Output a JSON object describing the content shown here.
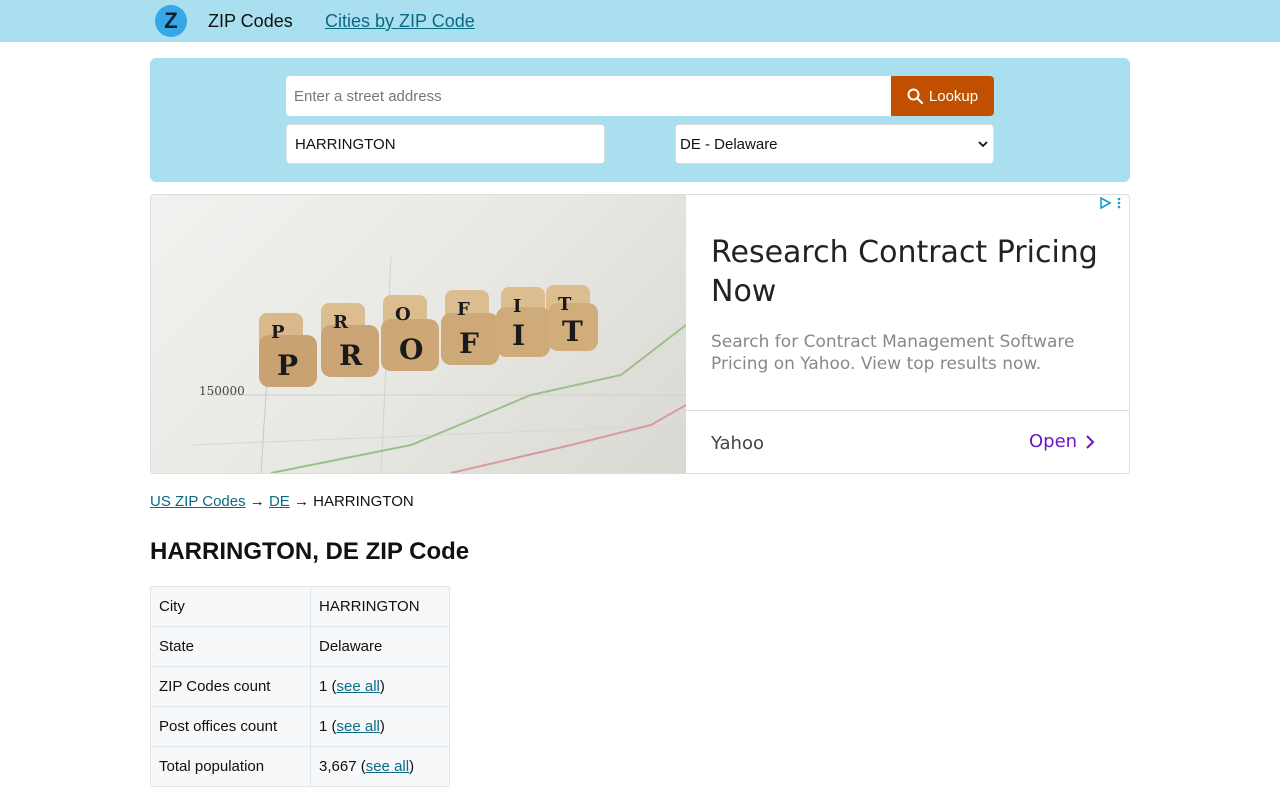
{
  "header": {
    "logo_letter": "Z",
    "brand": "ZIP Codes",
    "nav_link": "Cities by ZIP Code"
  },
  "search": {
    "address_placeholder": "Enter a street address",
    "address_value": "",
    "lookup_label": "Lookup",
    "city_value": "HARRINGTON",
    "state_selected": "DE - Delaware",
    "accent_color": "#c05000"
  },
  "ad": {
    "headline": "Research Contract Pricing Now",
    "description": "Search for Contract Management Software Pricing on Yahoo. View top results now.",
    "source": "Yahoo",
    "cta": "Open",
    "image_dice": [
      "P",
      "R",
      "O",
      "F",
      "I",
      "T"
    ],
    "image_axis_label": "150000"
  },
  "breadcrumb": {
    "home": "US ZIP Codes",
    "sep1": "→",
    "state": "DE",
    "sep2": "→",
    "city": "HARRINGTON"
  },
  "page_title": "HARRINGTON, DE ZIP Code",
  "info_table": {
    "rows": [
      {
        "key": "City",
        "value": "HARRINGTON",
        "link": ""
      },
      {
        "key": "State",
        "value": "Delaware",
        "link": ""
      },
      {
        "key": "ZIP Codes count",
        "value": "1",
        "link": "see all"
      },
      {
        "key": "Post offices count",
        "value": "1",
        "link": "see all"
      },
      {
        "key": "Total population",
        "value": "3,667",
        "link": "see all"
      }
    ]
  }
}
